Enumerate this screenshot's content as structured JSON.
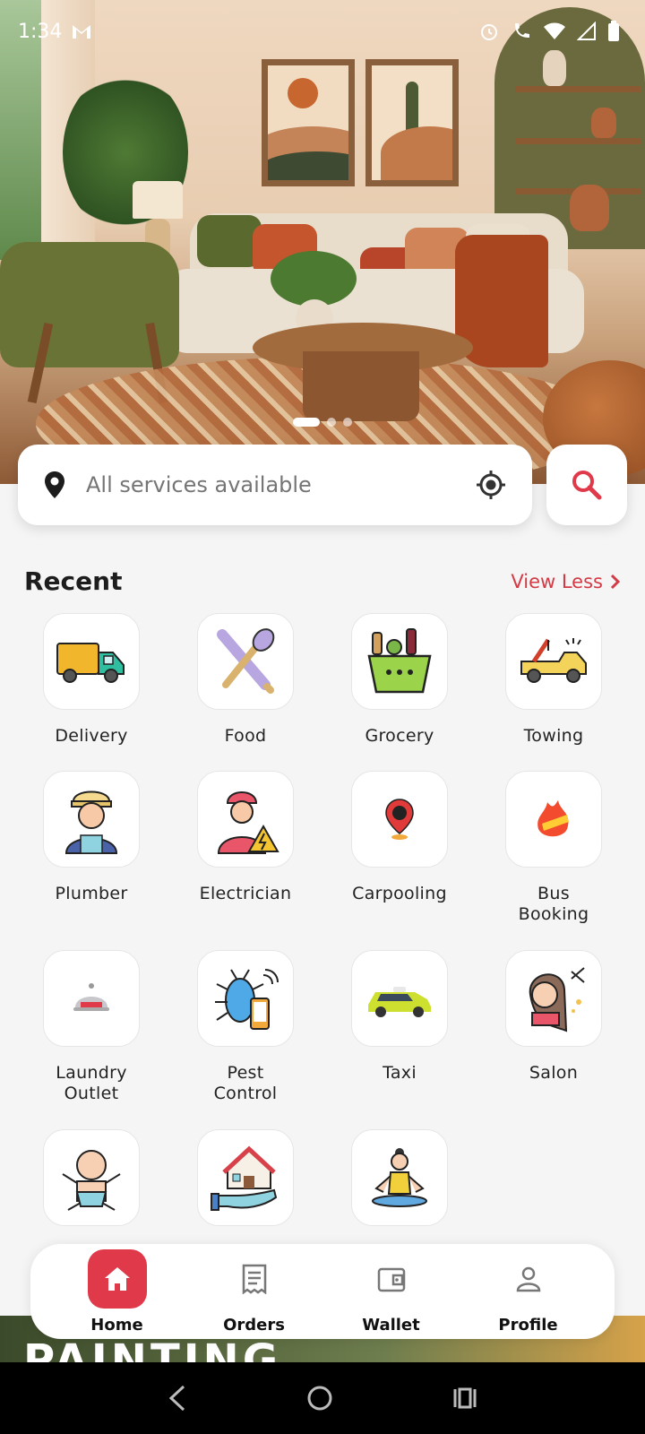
{
  "status_bar": {
    "time": "1:34"
  },
  "banner": {
    "slides": 3,
    "active_slide": 0
  },
  "search": {
    "placeholder": "All services available"
  },
  "recent": {
    "title": "Recent",
    "toggle_label": "View Less"
  },
  "services": [
    {
      "label": "Delivery",
      "icon": "delivery-truck-icon"
    },
    {
      "label": "Food",
      "icon": "fork-spoon-icon"
    },
    {
      "label": "Grocery",
      "icon": "grocery-basket-icon"
    },
    {
      "label": "Towing",
      "icon": "tow-truck-icon"
    },
    {
      "label": "Plumber",
      "icon": "plumber-icon"
    },
    {
      "label": "Electrician",
      "icon": "electrician-icon"
    },
    {
      "label": "Carpooling",
      "icon": "map-pin-car-icon"
    },
    {
      "label": "Bus\nBooking",
      "icon": "hot-deal-icon"
    },
    {
      "label": "Laundry\nOutlet",
      "icon": "cloche-icon"
    },
    {
      "label": "Pest\nControl",
      "icon": "bug-phone-icon"
    },
    {
      "label": "Taxi",
      "icon": "taxi-icon"
    },
    {
      "label": "Salon",
      "icon": "salon-icon"
    },
    {
      "label": "",
      "icon": "baby-icon"
    },
    {
      "label": "",
      "icon": "house-hand-icon"
    },
    {
      "label": "",
      "icon": "yoga-icon"
    }
  ],
  "bottom_nav": [
    {
      "label": "Home",
      "icon": "home-icon",
      "active": true
    },
    {
      "label": "Orders",
      "icon": "receipt-icon",
      "active": false
    },
    {
      "label": "Wallet",
      "icon": "wallet-icon",
      "active": false
    },
    {
      "label": "Profile",
      "icon": "person-icon",
      "active": false
    }
  ],
  "promo_banner": {
    "text": "PAINTING"
  },
  "colors": {
    "accent": "#e0394a",
    "link": "#d33a45",
    "background": "#f5f5f5"
  }
}
